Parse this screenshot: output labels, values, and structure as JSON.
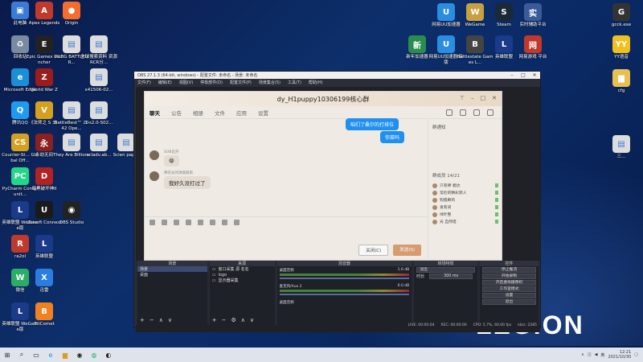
{
  "desktop": {
    "icons_left": [
      {
        "label": "此电脑",
        "color": "#3a7bd5",
        "glyph": "▣"
      },
      {
        "label": "Apex Legends",
        "color": "#c0392b",
        "glyph": "A"
      },
      {
        "label": "Origin",
        "color": "#f56c2d",
        "glyph": "●"
      },
      {
        "label": "回收站",
        "color": "#7a8aa0",
        "glyph": "♻"
      },
      {
        "label": "Epic Games Launcher",
        "color": "#222222",
        "glyph": "E"
      },
      {
        "label": "PUBG BATTLEGR...",
        "color": "#dddddd",
        "glyph": "▤"
      },
      {
        "label": "全球搜索资料 资源RCR分...",
        "color": "#dddddd",
        "glyph": "▤"
      },
      {
        "label": "Microsoft Edge",
        "color": "#1a8fd8",
        "glyph": "e"
      },
      {
        "label": "World War Z",
        "color": "#9b1c1c",
        "glyph": "Z"
      },
      {
        "label": "x41506-02...",
        "color": "#dddddd",
        "glyph": "▤"
      },
      {
        "label": "腾讯QQ",
        "color": "#1e9bf0",
        "glyph": "Q"
      },
      {
        "label": "《法师之 S 3》",
        "color": "#d4a020",
        "glyph": "V"
      },
      {
        "label": "BattleBest™ 2042 Ope...",
        "color": "#dddddd",
        "glyph": "▤"
      },
      {
        "label": "1-s2.0-S02...",
        "color": "#dddddd",
        "glyph": "▤"
      },
      {
        "label": "Counter-St... Global Off...",
        "color": "#d4a020",
        "glyph": "CS"
      },
      {
        "label": "永劫无间",
        "color": "#8a2020",
        "glyph": "永"
      },
      {
        "label": "They Are Billions",
        "color": "#dddddd",
        "glyph": "▤"
      },
      {
        "label": "scladv.ab...",
        "color": "#dddddd",
        "glyph": "▤"
      },
      {
        "label": "Scien paper",
        "color": "#dddddd",
        "glyph": "▤"
      },
      {
        "label": "PyCharm Communit...",
        "color": "#21d789",
        "glyph": "PC"
      },
      {
        "label": "暗黑破坏神II",
        "color": "#b22222",
        "glyph": "D"
      },
      {
        "label": "英雄联盟 WeGame版",
        "color": "#1a3a8a",
        "glyph": "L"
      },
      {
        "label": "Ubisoft Connect",
        "color": "#1a1a1a",
        "glyph": "U"
      },
      {
        "label": "OBS Studio",
        "color": "#222222",
        "glyph": "◉"
      },
      {
        "label": "ra2ol",
        "color": "#c0392b",
        "glyph": "R"
      },
      {
        "label": "英雄联盟",
        "color": "#1a3a8a",
        "glyph": "L"
      },
      {
        "label": "微信",
        "color": "#2aae67",
        "glyph": "W"
      },
      {
        "label": "迅雷",
        "color": "#2a7de1",
        "glyph": "X"
      },
      {
        "label": "英雄联盟 WeGame版",
        "color": "#1a3a8a",
        "glyph": "L"
      },
      {
        "label": "BitComet",
        "color": "#f08020",
        "glyph": "B"
      }
    ],
    "icons_right": [
      {
        "label": "网易UU加速器",
        "color": "#2a8de1",
        "glyph": "U"
      },
      {
        "label": "WeGame",
        "color": "#c8a040",
        "glyph": "W"
      },
      {
        "label": "Steam",
        "color": "#1b2838",
        "glyph": "S"
      },
      {
        "label": "实时辅助平台",
        "color": "#3a5a9a",
        "glyph": "实"
      },
      {
        "label": "gcck.exe",
        "color": "#333333",
        "glyph": "G"
      },
      {
        "label": "新年加速器",
        "color": "#2a8d4e",
        "glyph": "新"
      },
      {
        "label": "网易UU加速器 新版",
        "color": "#2a8de1",
        "glyph": "U"
      },
      {
        "label": "Battlestate Games L...",
        "color": "#444444",
        "glyph": "B"
      },
      {
        "label": "英雄联盟",
        "color": "#1a3a8a",
        "glyph": "L"
      },
      {
        "label": "网易游戏 平台",
        "color": "#c0392b",
        "glyph": "网"
      },
      {
        "label": "YY语音",
        "color": "#f0c020",
        "glyph": "YY"
      },
      {
        "label": "cfg",
        "color": "#e8c050",
        "glyph": "▆"
      },
      {
        "label": "三...",
        "color": "#dddddd",
        "glyph": "▤"
      }
    ],
    "legion_text": "LEGION"
  },
  "obs": {
    "title": "OBS 27.1.3 (64-bit, windows) - 配置文件: 未命名 - 场景: 未命名",
    "menu": [
      "文件(F)",
      "编辑(E)",
      "视图(V)",
      "停靠部件(D)",
      "配置文件(P)",
      "场景集合(S)",
      "工具(T)",
      "帮助(H)"
    ],
    "docks": {
      "scenes_title": "场景",
      "scenes": [
        "场景",
        "桌面"
      ],
      "sources_title": "来源",
      "sources": [
        "窗口采集 源 名名",
        "logo",
        "显示器采集"
      ],
      "mixer_title": "混音器",
      "mixer": [
        {
          "name": "桌面音频",
          "level": "1.6 dB"
        },
        {
          "name": "麦克风/Aux 2",
          "level": "0.0 dB"
        },
        {
          "name": "桌面音频",
          "level": ""
        }
      ],
      "transition_title": "转场特效",
      "transition_type": "淡出",
      "duration_label": "时长",
      "duration_value": "300 ms",
      "controls_title": "控件",
      "controls": [
        "停止推流",
        "开始录制",
        "开启虚拟摄像机",
        "工作室模式",
        "设置",
        "退出"
      ]
    },
    "status": [
      "LIVE: 00:00:04",
      "REC: 00:00:00",
      "CPU: 5.7%, 60.00 fps",
      "kb/s: 2285"
    ]
  },
  "qq": {
    "title": "dy_H1puppy10306199核心群",
    "tabs": [
      "聊天",
      "公告",
      "相册",
      "文件",
      "应用",
      "设置"
    ],
    "messages": [
      {
        "text": "咱们了桑尔的打排位",
        "side": "out"
      },
      {
        "text": "你菜吗",
        "side": "out"
      },
      {
        "meta": "SOB出开",
        "text": "😁",
        "side": "in"
      },
      {
        "meta": "棉花总的球伽丽斯",
        "text": "我好久没打过了",
        "side": "in"
      }
    ],
    "notice_title": "群通知",
    "members_title": "群成员 14/21",
    "members": [
      "只有稀 嘘达",
      "常伦的精彩默人",
      "钩蔻刷鸡",
      "发有间",
      "绿叶整",
      "光 自然塔"
    ],
    "close_btn": "关闭(C)",
    "send_btn": "发送(S)"
  },
  "taskbar": {
    "time": "12:21",
    "date": "2021/10/30",
    "lang": "英"
  }
}
